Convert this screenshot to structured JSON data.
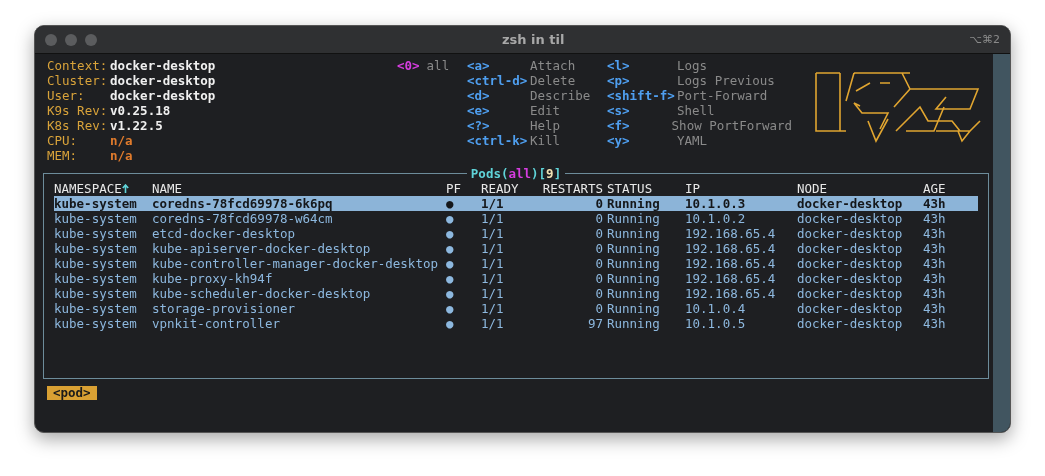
{
  "window": {
    "title": "zsh in til",
    "shortcut": "⌥⌘2"
  },
  "info": [
    {
      "label": "Context:",
      "value": "docker-desktop",
      "kind": "plain"
    },
    {
      "label": "Cluster:",
      "value": "docker-desktop",
      "kind": "plain"
    },
    {
      "label": "User:",
      "value": "docker-desktop",
      "kind": "plain"
    },
    {
      "label": "K9s Rev:",
      "value": "v0.25.18",
      "kind": "plain"
    },
    {
      "label": "K8s Rev:",
      "value": "v1.22.5",
      "kind": "plain"
    },
    {
      "label": "CPU:",
      "value": "n/a",
      "kind": "metric"
    },
    {
      "label": "MEM:",
      "value": "n/a",
      "kind": "metric"
    }
  ],
  "namespaces": [
    {
      "key": "<0>",
      "label": "all"
    }
  ],
  "shortcut_columns": [
    [
      {
        "key": "<a>",
        "action": "Attach"
      },
      {
        "key": "<ctrl-d>",
        "action": "Delete"
      },
      {
        "key": "<d>",
        "action": "Describe"
      },
      {
        "key": "<e>",
        "action": "Edit"
      },
      {
        "key": "<?>",
        "action": "Help"
      },
      {
        "key": "<ctrl-k>",
        "action": "Kill"
      }
    ],
    [
      {
        "key": "<l>",
        "action": "Logs"
      },
      {
        "key": "<p>",
        "action": "Logs Previous"
      },
      {
        "key": "<shift-f>",
        "action": "Port-Forward"
      },
      {
        "key": "<s>",
        "action": "Shell"
      },
      {
        "key": "<f>",
        "action": "Show PortForward"
      },
      {
        "key": "<y>",
        "action": "YAML"
      }
    ]
  ],
  "table": {
    "title": "Pods",
    "title_open": "(",
    "filter": "all",
    "title_mid": ")[",
    "count": "9",
    "title_close": "]",
    "columns": [
      {
        "label": "NAMESPACE",
        "sorted": true
      },
      {
        "label": "NAME",
        "sorted": false
      },
      {
        "label": "PF",
        "sorted": false
      },
      {
        "label": "READY",
        "sorted": false
      },
      {
        "label": "RESTARTS",
        "sorted": false
      },
      {
        "label": "STATUS",
        "sorted": false
      },
      {
        "label": "IP",
        "sorted": false
      },
      {
        "label": "NODE",
        "sorted": false
      },
      {
        "label": "AGE",
        "sorted": false
      }
    ],
    "rows": [
      {
        "selected": true,
        "cells": [
          "kube-system",
          "coredns-78fcd69978-6k6pq",
          "●",
          "1/1",
          "0",
          "Running",
          "10.1.0.3",
          "docker-desktop",
          "43h"
        ]
      },
      {
        "selected": false,
        "cells": [
          "kube-system",
          "coredns-78fcd69978-w64cm",
          "●",
          "1/1",
          "0",
          "Running",
          "10.1.0.2",
          "docker-desktop",
          "43h"
        ]
      },
      {
        "selected": false,
        "cells": [
          "kube-system",
          "etcd-docker-desktop",
          "●",
          "1/1",
          "0",
          "Running",
          "192.168.65.4",
          "docker-desktop",
          "43h"
        ]
      },
      {
        "selected": false,
        "cells": [
          "kube-system",
          "kube-apiserver-docker-desktop",
          "●",
          "1/1",
          "0",
          "Running",
          "192.168.65.4",
          "docker-desktop",
          "43h"
        ]
      },
      {
        "selected": false,
        "cells": [
          "kube-system",
          "kube-controller-manager-docker-desktop",
          "●",
          "1/1",
          "0",
          "Running",
          "192.168.65.4",
          "docker-desktop",
          "43h"
        ]
      },
      {
        "selected": false,
        "cells": [
          "kube-system",
          "kube-proxy-kh94f",
          "●",
          "1/1",
          "0",
          "Running",
          "192.168.65.4",
          "docker-desktop",
          "43h"
        ]
      },
      {
        "selected": false,
        "cells": [
          "kube-system",
          "kube-scheduler-docker-desktop",
          "●",
          "1/1",
          "0",
          "Running",
          "192.168.65.4",
          "docker-desktop",
          "43h"
        ]
      },
      {
        "selected": false,
        "cells": [
          "kube-system",
          "storage-provisioner",
          "●",
          "1/1",
          "0",
          "Running",
          "10.1.0.4",
          "docker-desktop",
          "43h"
        ]
      },
      {
        "selected": false,
        "cells": [
          "kube-system",
          "vpnkit-controller",
          "●",
          "1/1",
          "97",
          "Running",
          "10.1.0.5",
          "docker-desktop",
          "43h"
        ]
      }
    ]
  },
  "crumbs": [
    {
      "label": "<pod>"
    }
  ]
}
